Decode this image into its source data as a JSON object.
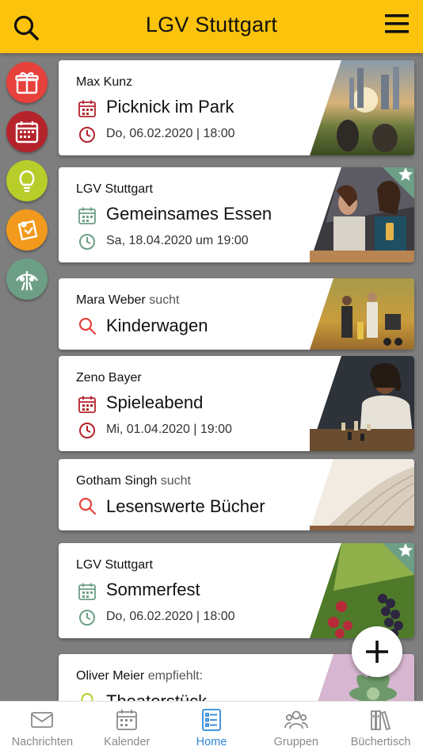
{
  "header": {
    "title": "LGV Stuttgart",
    "search_icon": "search-icon",
    "menu_icon": "hamburger-menu-icon"
  },
  "sidebar": [
    {
      "name": "gift-icon",
      "color": "#e7413c"
    },
    {
      "name": "calendar-icon",
      "color": "#b5232b"
    },
    {
      "name": "lightbulb-icon",
      "color": "#b8cc2a"
    },
    {
      "name": "note-icon",
      "color": "#f19a1d"
    },
    {
      "name": "group-icon",
      "color": "#6d9f86"
    }
  ],
  "cards": [
    {
      "author": "Max Kunz",
      "suffix": "",
      "title": "Picknick im Park",
      "date": "Do, 06.02.2020 | 18:00",
      "type": "event",
      "accent": "#b5232b",
      "starred": false
    },
    {
      "author": "LGV Stuttgart",
      "suffix": "",
      "title": "Gemeinsames Essen",
      "date": "Sa, 18.04.2020 um 19:00",
      "type": "event",
      "accent": "#6d9f86",
      "starred": true
    },
    {
      "author": "Mara Weber",
      "suffix": "sucht",
      "title": "Kinderwagen",
      "date": "",
      "type": "search",
      "accent": "#e7413c",
      "starred": false
    },
    {
      "author": "Zeno Bayer",
      "suffix": "",
      "title": "Spieleabend",
      "date": "Mi, 01.04.2020 | 19:00",
      "type": "event",
      "accent": "#b5232b",
      "starred": false
    },
    {
      "author": "Gotham Singh",
      "suffix": "sucht",
      "title": "Lesenswerte Bücher",
      "date": "",
      "type": "search",
      "accent": "#e7413c",
      "starred": false
    },
    {
      "author": "LGV Stuttgart",
      "suffix": "",
      "title": "Sommerfest",
      "date": "Do, 06.02.2020 | 18:00",
      "type": "event",
      "accent": "#6d9f86",
      "starred": true
    },
    {
      "author": "Oliver Meier",
      "suffix": "empfiehlt:",
      "title": "Theaterstück",
      "date": "",
      "type": "recommend",
      "accent": "#b8cc2a",
      "starred": false
    }
  ],
  "fab": {
    "icon": "plus-icon"
  },
  "tabbar": [
    {
      "label": "Nachrichten",
      "icon": "mail-icon",
      "active": false
    },
    {
      "label": "Kalender",
      "icon": "calendar-icon",
      "active": false
    },
    {
      "label": "Home",
      "icon": "home-list-icon",
      "active": true
    },
    {
      "label": "Gruppen",
      "icon": "people-icon",
      "active": false
    },
    {
      "label": "Büchertisch",
      "icon": "books-icon",
      "active": false
    }
  ]
}
